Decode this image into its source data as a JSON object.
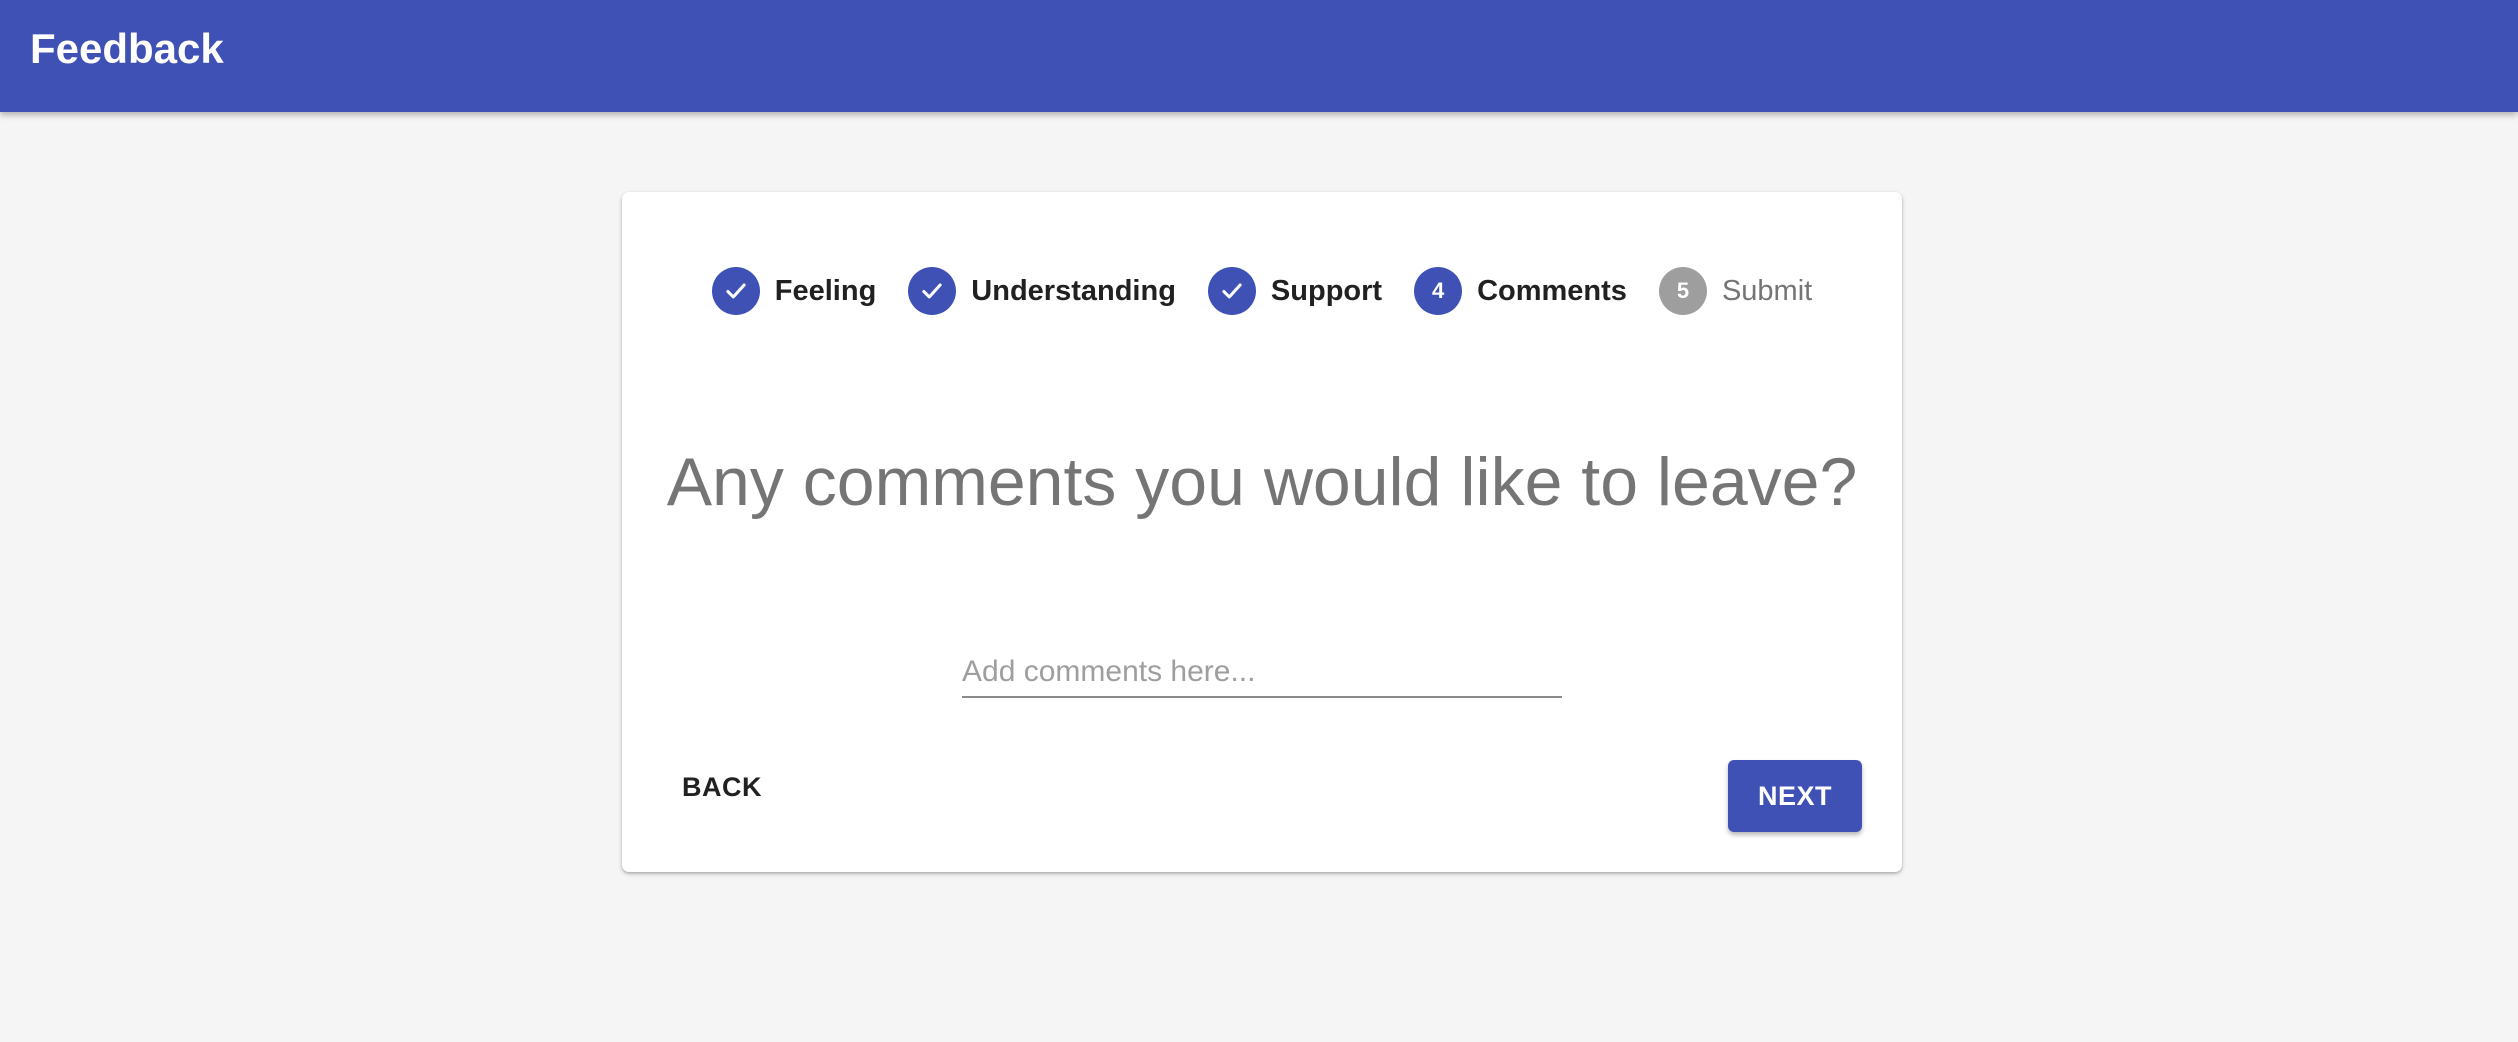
{
  "app_bar": {
    "title": "Feedback",
    "color": "#3f51b5"
  },
  "stepper": {
    "steps": [
      {
        "label": "Feeling",
        "state": "completed",
        "icon": "check-icon"
      },
      {
        "label": "Understanding",
        "state": "completed",
        "icon": "check-icon"
      },
      {
        "label": "Support",
        "state": "completed",
        "icon": "check-icon"
      },
      {
        "label": "Comments",
        "state": "active",
        "number": "4"
      },
      {
        "label": "Submit",
        "state": "pending",
        "number": "5"
      }
    ],
    "active_color": "#3f51b5",
    "pending_color": "#9e9e9e"
  },
  "main": {
    "question": "Any comments you would like to leave?",
    "comment_input": {
      "value": "",
      "placeholder": "Add comments here..."
    }
  },
  "actions": {
    "back_label": "BACK",
    "next_label": "NEXT"
  }
}
